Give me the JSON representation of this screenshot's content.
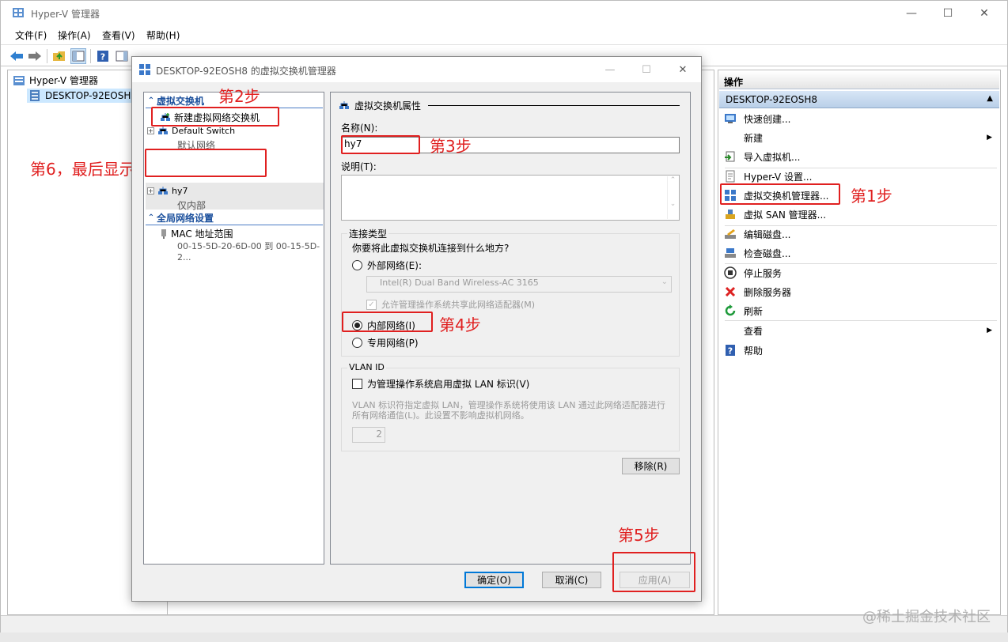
{
  "main": {
    "title": "Hyper-V 管理器",
    "menu": [
      "文件(F)",
      "操作(A)",
      "查看(V)",
      "帮助(H)"
    ],
    "tree": {
      "root": "Hyper-V 管理器",
      "host": "DESKTOP-92EOSH8"
    }
  },
  "actions": {
    "title": "操作",
    "group": "DESKTOP-92EOSH8",
    "items": [
      {
        "label": "快速创建...",
        "icon": "quick-create-icon"
      },
      {
        "label": "新建",
        "icon": "new-icon",
        "submenu": true
      },
      {
        "label": "导入虚拟机...",
        "icon": "import-icon"
      },
      {
        "label": "Hyper-V 设置...",
        "icon": "settings-icon"
      },
      {
        "label": "虚拟交换机管理器...",
        "icon": "switch-manager-icon"
      },
      {
        "label": "虚拟 SAN 管理器...",
        "icon": "san-manager-icon"
      },
      {
        "label": "编辑磁盘...",
        "icon": "edit-disk-icon"
      },
      {
        "label": "检查磁盘...",
        "icon": "inspect-disk-icon"
      },
      {
        "label": "停止服务",
        "icon": "stop-icon"
      },
      {
        "label": "删除服务器",
        "icon": "delete-icon"
      },
      {
        "label": "刷新",
        "icon": "refresh-icon"
      },
      {
        "label": "查看",
        "icon": "view-icon",
        "submenu": true
      },
      {
        "label": "帮助",
        "icon": "help-icon"
      }
    ]
  },
  "dialog": {
    "title": "DESKTOP-92EOSH8 的虚拟交换机管理器",
    "tree": {
      "section_switches": "虚拟交换机",
      "new_switch": "新建虚拟网络交换机",
      "default_switch": "Default Switch",
      "default_switch_sub": "默认网络",
      "hy7": "hy7",
      "hy7_sub": "仅内部",
      "section_global": "全局网络设置",
      "mac": "MAC 地址范围",
      "mac_sub": "00-15-5D-20-6D-00 到 00-15-5D-2..."
    },
    "props": {
      "header": "虚拟交换机属性",
      "name_label": "名称(N):",
      "name_value": "hy7",
      "desc_label": "说明(T):",
      "conn_group": "连接类型",
      "conn_question": "你要将此虚拟交换机连接到什么地方?",
      "external": "外部网络(E):",
      "adapter": "Intel(R) Dual Band Wireless-AC 3165",
      "allow_share": "允许管理操作系统共享此网络适配器(M)",
      "internal": "内部网络(I)",
      "private": "专用网络(P)",
      "vlan_group": "VLAN ID",
      "vlan_enable": "为管理操作系统启用虚拟 LAN 标识(V)",
      "vlan_desc": "VLAN 标识符指定虚拟 LAN，管理操作系统将使用该 LAN 通过此网络适配器进行所有网络通信(L)。此设置不影响虚拟机网络。",
      "vlan_value": "2",
      "remove": "移除(R)"
    },
    "buttons": {
      "ok": "确定(O)",
      "cancel": "取消(C)",
      "apply": "应用(A)"
    }
  },
  "annotations": {
    "step1": "第1步",
    "step2": "第2步",
    "step3": "第3步",
    "step4": "第4步",
    "step5": "第5步",
    "step6": "第6，最后显示"
  },
  "watermark": "@稀土掘金技术社区",
  "colors": {
    "annotation": "#e02020",
    "section": "#1a4f9c",
    "selection": "#cce8ff"
  }
}
